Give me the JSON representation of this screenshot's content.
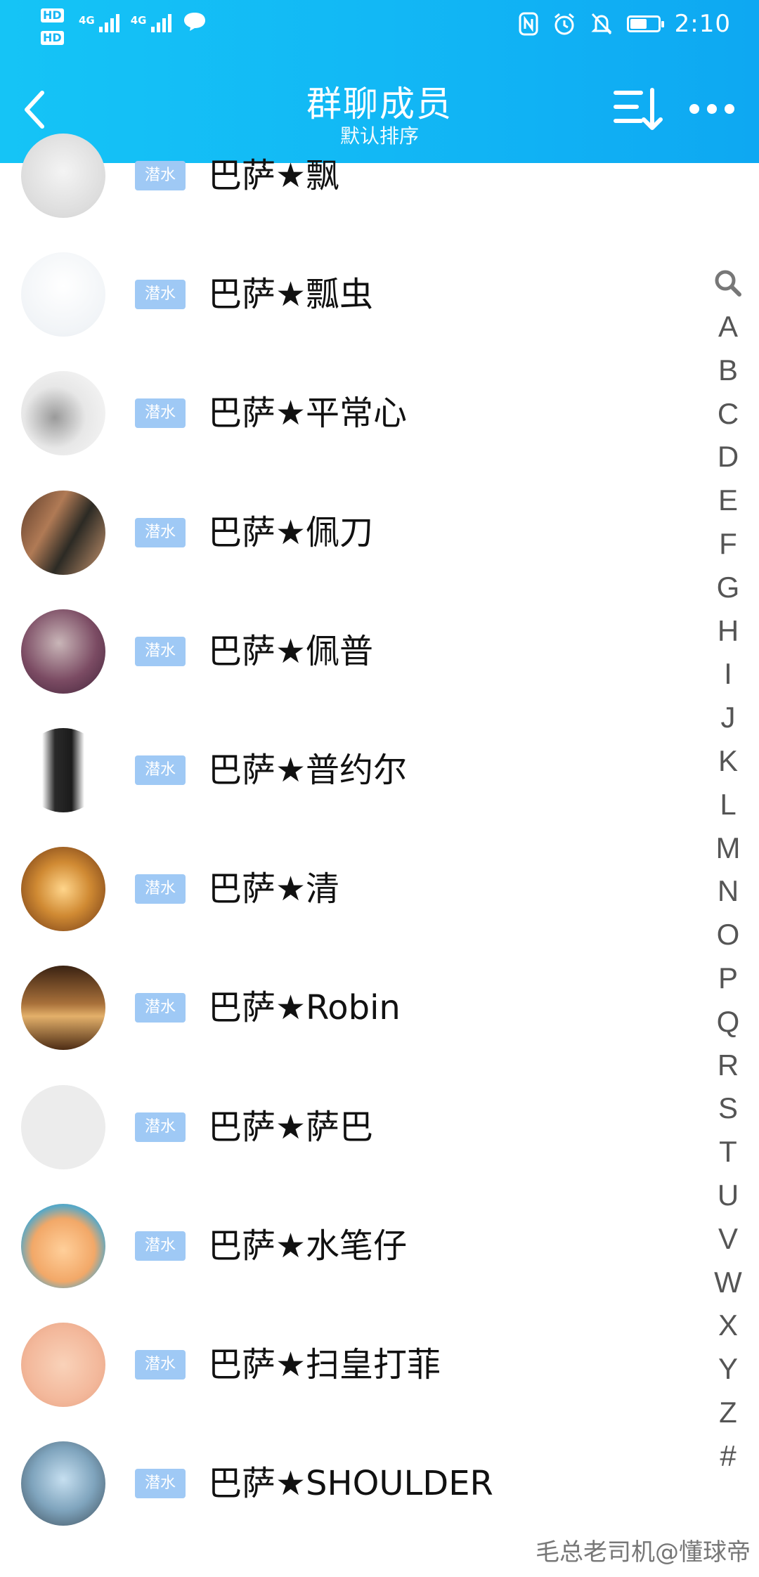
{
  "status_bar": {
    "hd1": "HD",
    "hd2": "HD",
    "net1": "4G",
    "net2": "4G",
    "time": "2:10",
    "battery_level": 0.55
  },
  "header": {
    "title": "群聊成员",
    "subtitle": "默认排序"
  },
  "members": [
    {
      "badge": "潜水",
      "name": "巴萨★飘"
    },
    {
      "badge": "潜水",
      "name": "巴萨★瓢虫"
    },
    {
      "badge": "潜水",
      "name": "巴萨★平常心"
    },
    {
      "badge": "潜水",
      "name": "巴萨★佩刀"
    },
    {
      "badge": "潜水",
      "name": "巴萨★佩普"
    },
    {
      "badge": "潜水",
      "name": "巴萨★普约尔"
    },
    {
      "badge": "潜水",
      "name": "巴萨★清"
    },
    {
      "badge": "潜水",
      "name": "巴萨★Robin"
    },
    {
      "badge": "潜水",
      "name": "巴萨★萨巴"
    },
    {
      "badge": "潜水",
      "name": "巴萨★水笔仔"
    },
    {
      "badge": "潜水",
      "name": "巴萨★扫皇打菲"
    },
    {
      "badge": "潜水",
      "name": "巴萨★SHOULDER"
    }
  ],
  "index_letters": [
    "A",
    "B",
    "C",
    "D",
    "E",
    "F",
    "G",
    "H",
    "I",
    "J",
    "K",
    "L",
    "M",
    "N",
    "O",
    "P",
    "Q",
    "R",
    "S",
    "T",
    "U",
    "V",
    "W",
    "X",
    "Y",
    "Z",
    "#"
  ],
  "watermark": "毛总老司机@懂球帝",
  "colors": {
    "header": "#12b8f5",
    "badge": "#9fc9f5"
  }
}
